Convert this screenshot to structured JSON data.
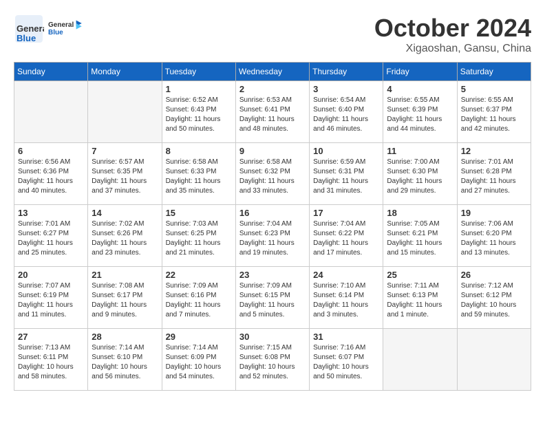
{
  "header": {
    "logo": {
      "general": "General",
      "blue": "Blue"
    },
    "title": "October 2024",
    "location": "Xigaoshan, Gansu, China"
  },
  "weekdays": [
    "Sunday",
    "Monday",
    "Tuesday",
    "Wednesday",
    "Thursday",
    "Friday",
    "Saturday"
  ],
  "weeks": [
    [
      {
        "day": "",
        "info": ""
      },
      {
        "day": "",
        "info": ""
      },
      {
        "day": "1",
        "sunrise": "Sunrise: 6:52 AM",
        "sunset": "Sunset: 6:43 PM",
        "daylight": "Daylight: 11 hours and 50 minutes."
      },
      {
        "day": "2",
        "sunrise": "Sunrise: 6:53 AM",
        "sunset": "Sunset: 6:41 PM",
        "daylight": "Daylight: 11 hours and 48 minutes."
      },
      {
        "day": "3",
        "sunrise": "Sunrise: 6:54 AM",
        "sunset": "Sunset: 6:40 PM",
        "daylight": "Daylight: 11 hours and 46 minutes."
      },
      {
        "day": "4",
        "sunrise": "Sunrise: 6:55 AM",
        "sunset": "Sunset: 6:39 PM",
        "daylight": "Daylight: 11 hours and 44 minutes."
      },
      {
        "day": "5",
        "sunrise": "Sunrise: 6:55 AM",
        "sunset": "Sunset: 6:37 PM",
        "daylight": "Daylight: 11 hours and 42 minutes."
      }
    ],
    [
      {
        "day": "6",
        "sunrise": "Sunrise: 6:56 AM",
        "sunset": "Sunset: 6:36 PM",
        "daylight": "Daylight: 11 hours and 40 minutes."
      },
      {
        "day": "7",
        "sunrise": "Sunrise: 6:57 AM",
        "sunset": "Sunset: 6:35 PM",
        "daylight": "Daylight: 11 hours and 37 minutes."
      },
      {
        "day": "8",
        "sunrise": "Sunrise: 6:58 AM",
        "sunset": "Sunset: 6:33 PM",
        "daylight": "Daylight: 11 hours and 35 minutes."
      },
      {
        "day": "9",
        "sunrise": "Sunrise: 6:58 AM",
        "sunset": "Sunset: 6:32 PM",
        "daylight": "Daylight: 11 hours and 33 minutes."
      },
      {
        "day": "10",
        "sunrise": "Sunrise: 6:59 AM",
        "sunset": "Sunset: 6:31 PM",
        "daylight": "Daylight: 11 hours and 31 minutes."
      },
      {
        "day": "11",
        "sunrise": "Sunrise: 7:00 AM",
        "sunset": "Sunset: 6:30 PM",
        "daylight": "Daylight: 11 hours and 29 minutes."
      },
      {
        "day": "12",
        "sunrise": "Sunrise: 7:01 AM",
        "sunset": "Sunset: 6:28 PM",
        "daylight": "Daylight: 11 hours and 27 minutes."
      }
    ],
    [
      {
        "day": "13",
        "sunrise": "Sunrise: 7:01 AM",
        "sunset": "Sunset: 6:27 PM",
        "daylight": "Daylight: 11 hours and 25 minutes."
      },
      {
        "day": "14",
        "sunrise": "Sunrise: 7:02 AM",
        "sunset": "Sunset: 6:26 PM",
        "daylight": "Daylight: 11 hours and 23 minutes."
      },
      {
        "day": "15",
        "sunrise": "Sunrise: 7:03 AM",
        "sunset": "Sunset: 6:25 PM",
        "daylight": "Daylight: 11 hours and 21 minutes."
      },
      {
        "day": "16",
        "sunrise": "Sunrise: 7:04 AM",
        "sunset": "Sunset: 6:23 PM",
        "daylight": "Daylight: 11 hours and 19 minutes."
      },
      {
        "day": "17",
        "sunrise": "Sunrise: 7:04 AM",
        "sunset": "Sunset: 6:22 PM",
        "daylight": "Daylight: 11 hours and 17 minutes."
      },
      {
        "day": "18",
        "sunrise": "Sunrise: 7:05 AM",
        "sunset": "Sunset: 6:21 PM",
        "daylight": "Daylight: 11 hours and 15 minutes."
      },
      {
        "day": "19",
        "sunrise": "Sunrise: 7:06 AM",
        "sunset": "Sunset: 6:20 PM",
        "daylight": "Daylight: 11 hours and 13 minutes."
      }
    ],
    [
      {
        "day": "20",
        "sunrise": "Sunrise: 7:07 AM",
        "sunset": "Sunset: 6:19 PM",
        "daylight": "Daylight: 11 hours and 11 minutes."
      },
      {
        "day": "21",
        "sunrise": "Sunrise: 7:08 AM",
        "sunset": "Sunset: 6:17 PM",
        "daylight": "Daylight: 11 hours and 9 minutes."
      },
      {
        "day": "22",
        "sunrise": "Sunrise: 7:09 AM",
        "sunset": "Sunset: 6:16 PM",
        "daylight": "Daylight: 11 hours and 7 minutes."
      },
      {
        "day": "23",
        "sunrise": "Sunrise: 7:09 AM",
        "sunset": "Sunset: 6:15 PM",
        "daylight": "Daylight: 11 hours and 5 minutes."
      },
      {
        "day": "24",
        "sunrise": "Sunrise: 7:10 AM",
        "sunset": "Sunset: 6:14 PM",
        "daylight": "Daylight: 11 hours and 3 minutes."
      },
      {
        "day": "25",
        "sunrise": "Sunrise: 7:11 AM",
        "sunset": "Sunset: 6:13 PM",
        "daylight": "Daylight: 11 hours and 1 minute."
      },
      {
        "day": "26",
        "sunrise": "Sunrise: 7:12 AM",
        "sunset": "Sunset: 6:12 PM",
        "daylight": "Daylight: 10 hours and 59 minutes."
      }
    ],
    [
      {
        "day": "27",
        "sunrise": "Sunrise: 7:13 AM",
        "sunset": "Sunset: 6:11 PM",
        "daylight": "Daylight: 10 hours and 58 minutes."
      },
      {
        "day": "28",
        "sunrise": "Sunrise: 7:14 AM",
        "sunset": "Sunset: 6:10 PM",
        "daylight": "Daylight: 10 hours and 56 minutes."
      },
      {
        "day": "29",
        "sunrise": "Sunrise: 7:14 AM",
        "sunset": "Sunset: 6:09 PM",
        "daylight": "Daylight: 10 hours and 54 minutes."
      },
      {
        "day": "30",
        "sunrise": "Sunrise: 7:15 AM",
        "sunset": "Sunset: 6:08 PM",
        "daylight": "Daylight: 10 hours and 52 minutes."
      },
      {
        "day": "31",
        "sunrise": "Sunrise: 7:16 AM",
        "sunset": "Sunset: 6:07 PM",
        "daylight": "Daylight: 10 hours and 50 minutes."
      },
      {
        "day": "",
        "info": ""
      },
      {
        "day": "",
        "info": ""
      }
    ]
  ]
}
